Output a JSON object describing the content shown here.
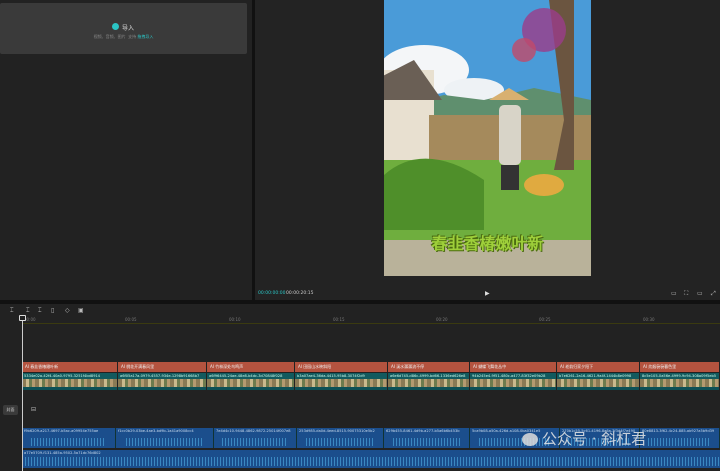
{
  "media": {
    "import_label": "导入",
    "import_hint_prefix": "视频、音频、图片",
    "import_hint_support": "支持",
    "import_hint_link": "拖拽导入"
  },
  "player": {
    "current_time": "00:00:00:00",
    "total_time": "00:00:20:15",
    "caption": "春韭香椿嫩叶新",
    "icons": [
      "ratio-icon",
      "fit-icon",
      "quality-icon",
      "fullscreen-icon"
    ]
  },
  "timeline": {
    "ruler": [
      "00:00",
      "00:05",
      "00:10",
      "00:15",
      "00:20",
      "00:25",
      "00:30"
    ],
    "text_clips": [
      "AI 春韭香椿嫩叶新",
      "AI 桃花开满春风里",
      "AI 竹林深处鸟鸣声",
      "AI 田园山水映斜阳",
      "AI 溪水潺潺流不停",
      "AI 蝴蝶飞舞花丛中",
      "AI 老翁归家夕阳下",
      "AI 炊烟袅袅暮色里"
    ],
    "video_clips": [
      "5334e02a-42f4-40a0-9795-3251f4bd8914",
      "a6f05a17a-0979-4557-934e-1298b91668b7",
      "a6f96445-24ae-48e8-b4dc-3d70848f028",
      "b3a07ae4-36da-4415-95b8-3074f2d9",
      "a6e6d745-d86c-4999-bd66-1336ed626e8",
      "94b245e4-9f51-480c-a477-83f32e09b28",
      "b7e6261-2a16-4621-9a4f-1444b8e0998",
      "8c5e105-0a56e-4999-9c94-308a09f5eb5"
    ],
    "cover_label": "封面",
    "audio_clips": [
      "f9b6209-a217-4697-b5ac-a09954e755ae",
      "f1cc0b29-03be-4ae3-bd9b-1a41a9008cc4",
      "7e4d4c10-9448-4862-9872-25014f007e8",
      "253d985-da0d-4eed-8515-90075310e5b2",
      "629b455-8461-4d9b-a277-b5a6b6b453b",
      "5ca9b08-a50a-426d-a108-0ba0341e5",
      "270b1c55-5c61-4196-8a6a-3f3d4f7e490",
      "80e8813-3f62-4c24-885-ab927a5b9d39"
    ],
    "bgm_clip": "a77e5709-f131-485a-9502-5a71dc76d802"
  },
  "watermark": "公众号 · 斜杠君"
}
